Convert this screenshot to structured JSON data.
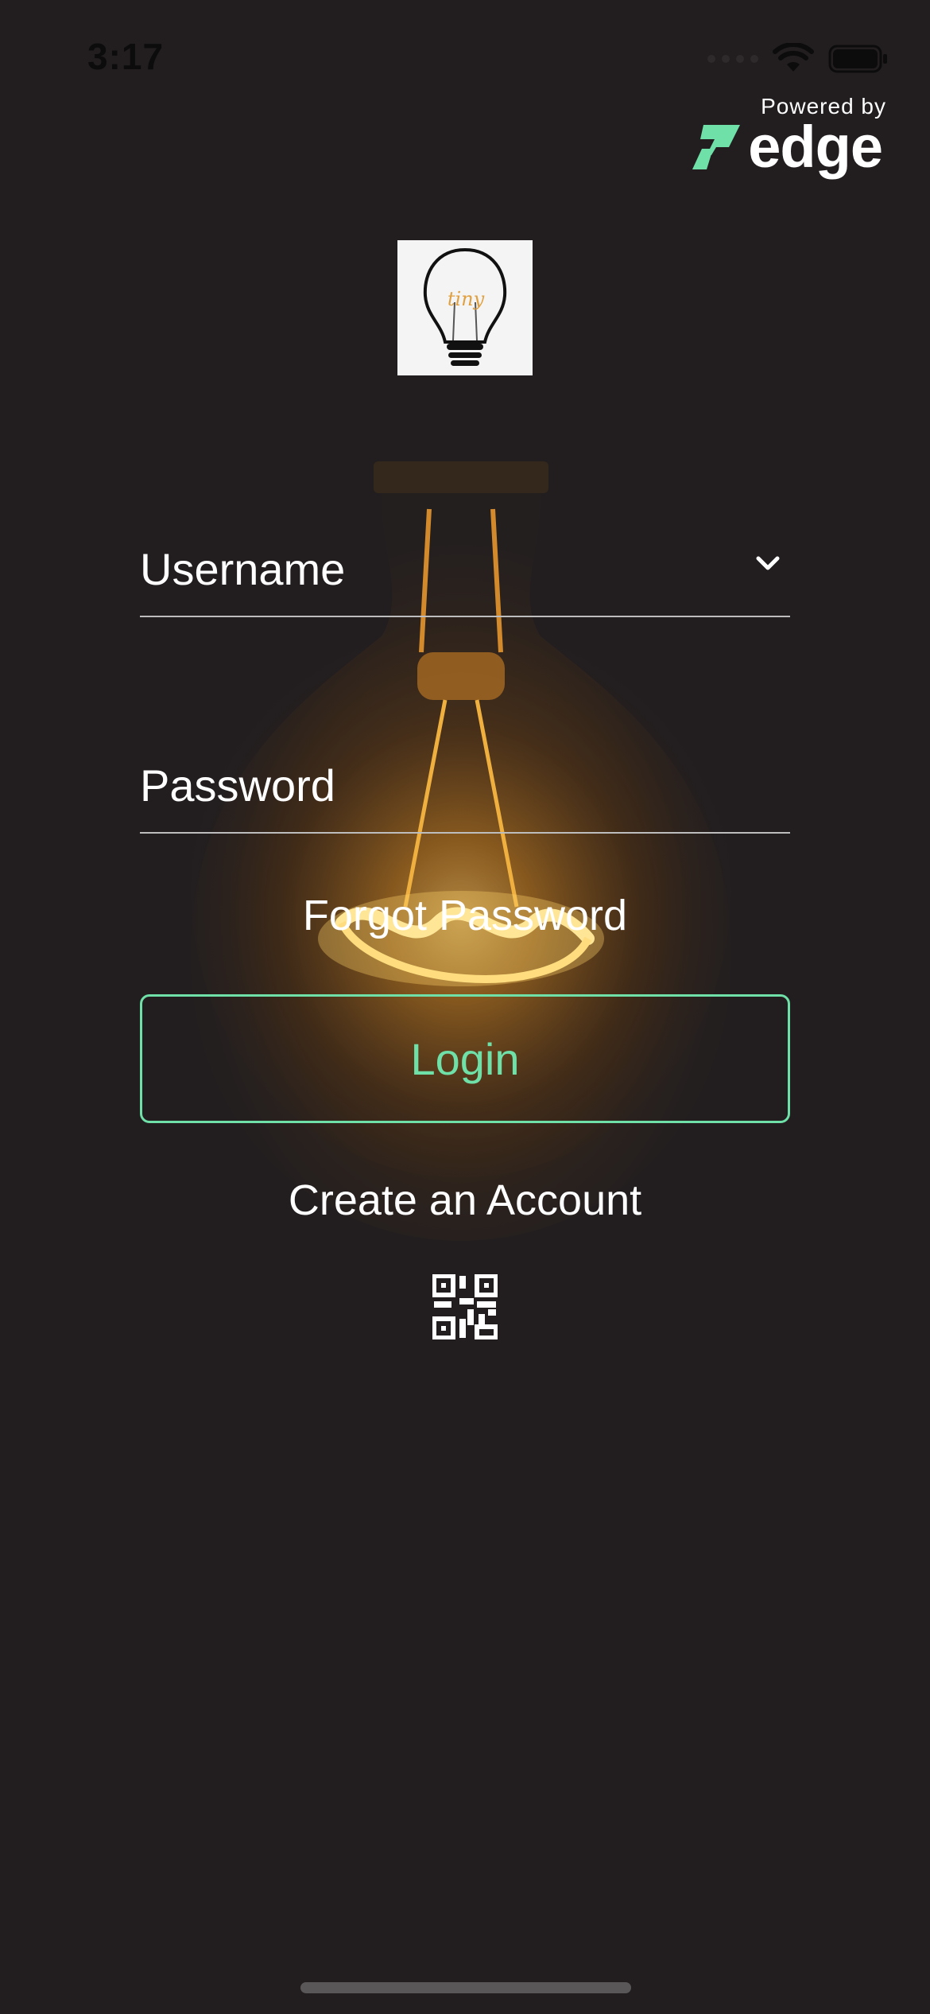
{
  "status_bar": {
    "time": "3:17",
    "icons": [
      "signal-icon",
      "wifi-icon",
      "battery-icon"
    ]
  },
  "branding": {
    "powered_by": "Powered by",
    "brand_name": "edge",
    "accent_color": "#6fe0a8",
    "app_logo_text": "tiny"
  },
  "form": {
    "username_label": "Username",
    "password_label": "Password",
    "forgot_password": "Forgot Password",
    "login_label": "Login",
    "create_account": "Create an Account"
  },
  "icons": {
    "username_dropdown": "chevron-down-icon",
    "scan": "qr-code-icon"
  }
}
